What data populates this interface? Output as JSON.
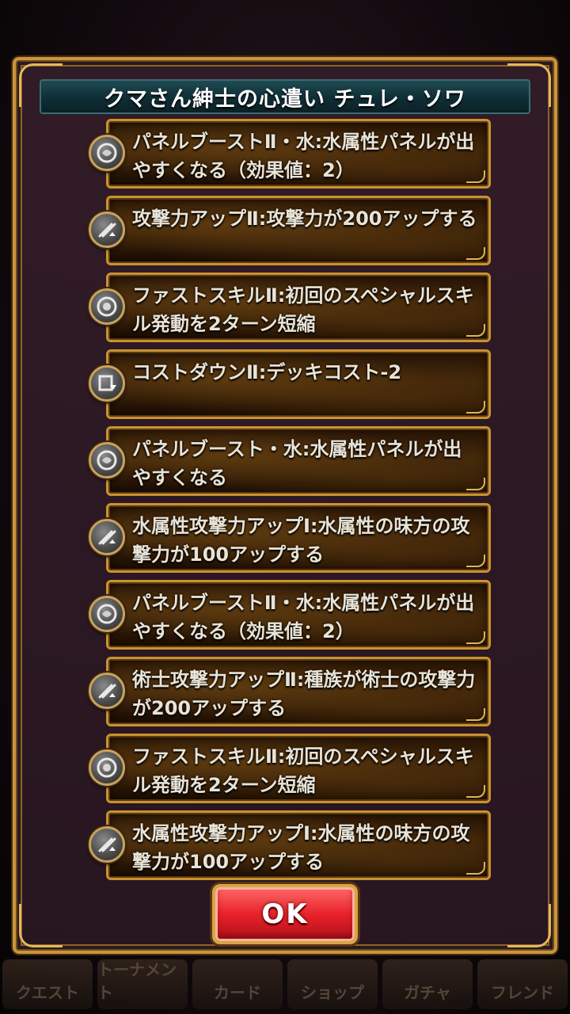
{
  "dialog": {
    "title": "クマさん紳士の心遣い チュレ・ソワ"
  },
  "skills": [
    {
      "icon": "panel-boost-icon",
      "text": "パネルブーストⅡ・水:水属性パネルが出やすくなる（効果値：2）"
    },
    {
      "icon": "attack-up-icon",
      "text": "攻撃力アップⅡ:攻撃力が200アップする"
    },
    {
      "icon": "fast-skill-icon",
      "text": "ファストスキルⅡ:初回のスペシャルスキル発動を2ターン短縮"
    },
    {
      "icon": "cost-down-icon",
      "text": "コストダウンⅡ:デッキコスト-2"
    },
    {
      "icon": "panel-boost-icon",
      "text": "パネルブースト・水:水属性パネルが出やすくなる"
    },
    {
      "icon": "attack-up-icon",
      "text": "水属性攻撃力アップⅠ:水属性の味方の攻撃力が100アップする"
    },
    {
      "icon": "panel-boost-icon",
      "text": "パネルブーストⅡ・水:水属性パネルが出やすくなる（効果値：2）"
    },
    {
      "icon": "attack-up-icon",
      "text": "術士攻撃力アップⅡ:種族が術士の攻撃力が200アップする"
    },
    {
      "icon": "fast-skill-icon",
      "text": "ファストスキルⅡ:初回のスペシャルスキル発動を2ターン短縮"
    },
    {
      "icon": "attack-up-icon",
      "text": "水属性攻撃力アップⅠ:水属性の味方の攻撃力が100アップする"
    }
  ],
  "ok_button": {
    "label": "OK"
  },
  "background_nav": [
    {
      "label": "クエスト"
    },
    {
      "label": "トーナメント"
    },
    {
      "label": "カード"
    },
    {
      "label": "ショップ"
    },
    {
      "label": "ガチャ"
    },
    {
      "label": "フレンド"
    }
  ],
  "colors": {
    "frame_gold": "#c9963a",
    "title_bg": "#0f2e35",
    "ok_red": "#e8222a"
  }
}
